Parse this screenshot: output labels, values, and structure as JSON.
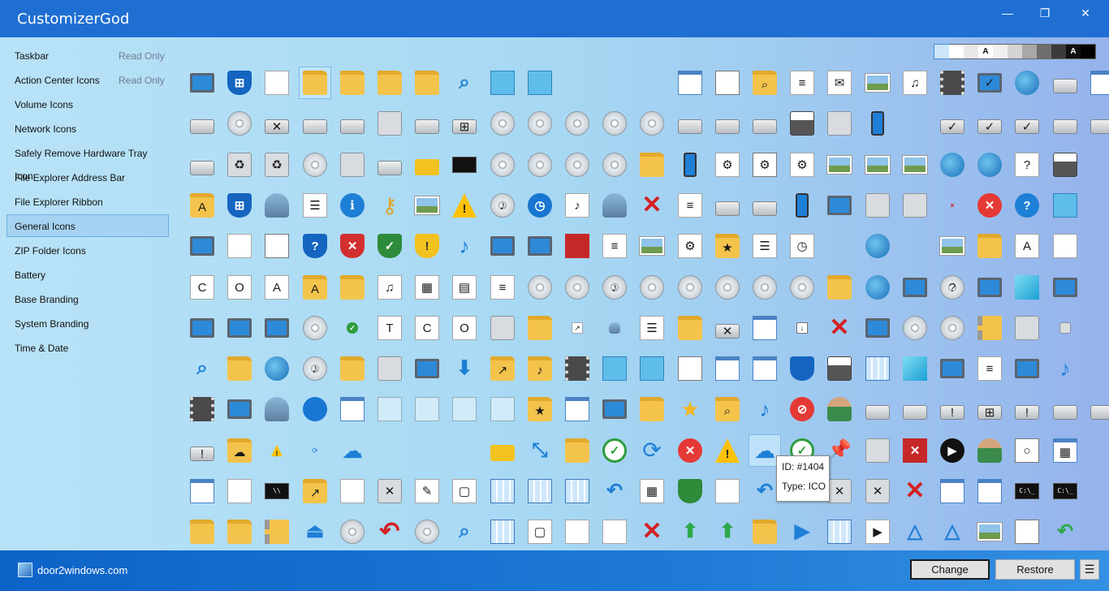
{
  "window": {
    "title": "CustomizerGod",
    "controls": {
      "minimize": "—",
      "maximize": "❐",
      "close": "✕"
    }
  },
  "sidebar": {
    "items": [
      {
        "label": "Taskbar",
        "badge": "Read Only"
      },
      {
        "label": "Action Center Icons",
        "badge": "Read Only"
      },
      {
        "label": "Volume Icons"
      },
      {
        "label": "Network Icons"
      },
      {
        "label": "Safely Remove Hardware Tray Icon"
      },
      {
        "label": "File Explorer Address Bar"
      },
      {
        "label": "File Explorer Ribbon"
      },
      {
        "label": "General Icons",
        "active": true
      },
      {
        "label": "ZIP Folder Icons"
      },
      {
        "label": "Battery"
      },
      {
        "label": "Base Branding"
      },
      {
        "label": "System Branding"
      },
      {
        "label": "Time & Date"
      }
    ]
  },
  "swatches": [
    {
      "color": "#cfe6fb",
      "selected": true
    },
    {
      "color": "#ffffff"
    },
    {
      "color": "#e8e8e8"
    },
    {
      "color": "#ffffff",
      "text": "A"
    },
    {
      "color": "#f0f0f0"
    },
    {
      "color": "#d4d4d4"
    },
    {
      "color": "#a8a8a8"
    },
    {
      "color": "#6e6e6e"
    },
    {
      "color": "#3a3a3a"
    },
    {
      "color": "#111111",
      "text": "A",
      "textColor": "#ffffff"
    },
    {
      "color": "#000000"
    }
  ],
  "grid": {
    "rows": [
      [
        "monitor",
        "winshield",
        "doc",
        "folder:sel",
        "folder",
        "folder",
        "folder-slim",
        "search-globe",
        "blue-folder",
        "blue-sliver",
        "empty",
        "empty",
        "empty",
        "window",
        "blank-tile",
        "folder-search",
        "doc-lines",
        "envelope",
        "picture",
        "music-doc",
        "film",
        "monitor-check",
        "globe-pc",
        "drive-pc",
        "id-card",
        "drive"
      ],
      [
        "drive",
        "disc-drive",
        "drive-x",
        "drive",
        "drive-green",
        "chip",
        "drive",
        "drive-win",
        "dvd",
        "dvd-r",
        "dvd-ram",
        "dvd-rom",
        "dvd-rw",
        "drive",
        "drive",
        "drive",
        "printer",
        "camcorder",
        "phone",
        "empty",
        "drive-check",
        "drive-check",
        "drive-check",
        "drive",
        "drive"
      ],
      [
        "drive-stack",
        "recycle",
        "recycle",
        "dvd",
        "camera",
        "drive",
        "lock",
        "sd-card",
        "disc",
        "cd-r",
        "cd-rom",
        "cd-rw",
        "board",
        "music-player",
        "gear-doc",
        "gear-tile",
        "gear-doc",
        "picture",
        "pictures",
        "picture",
        "globe-pc",
        "globe-pc",
        "help-pc",
        "printer"
      ],
      [
        "font-folder",
        "winshield",
        "people",
        "doc-list",
        "info",
        "key",
        "picture-red",
        "warning",
        "disc-music",
        "clock-blue",
        "audio-doc",
        "people",
        "x",
        "doc-lines",
        "drive",
        "drive-slim",
        "phone",
        "network",
        "scanner",
        "box",
        "x-small",
        "error",
        "help",
        "box-blue"
      ],
      [
        "monitor",
        "doc",
        "tile-small",
        "help-shield",
        "shield-x",
        "shield-check",
        "shield-warn",
        "music",
        "laptop",
        "monitor-blue",
        "apps",
        "doc-lines",
        "picture",
        "gear-doc",
        "star-folder",
        "list",
        "clock-doc",
        "empty",
        "globe-pc",
        "empty",
        "picture-red",
        "person-folder",
        "font-a",
        "certificate"
      ],
      [
        "certificate-c",
        "certificate-o",
        "font-a",
        "font-folder",
        "briefcase-person",
        "music-doc",
        "picture-doc",
        "film-doc",
        "doc-lines",
        "dvd",
        "dvd",
        "music-disc",
        "dvd",
        "hd-dvd",
        "bd",
        "vcd",
        "svcd",
        "green-folder",
        "globe",
        "search-pc",
        "help-disc",
        "sync-pc",
        "cube",
        "laptop-check"
      ],
      [
        "monitor-green",
        "monitor-tools",
        "network",
        "disc-red",
        "check-small",
        "font-tt",
        "font-c",
        "font-o",
        "audio",
        "folder-slim",
        "shortcut-small",
        "people-small",
        "list",
        "folder-doc",
        "drive-x",
        "id-card",
        "down-small",
        "x",
        "network",
        "dvd-r",
        "dvd-rw",
        "zip",
        "green-arrow-zip",
        "speaker-small"
      ],
      [
        "search",
        "people-folder",
        "globe-person",
        "music-add",
        "folder-card",
        "keyboard",
        "monitor-blue",
        "arrow-down",
        "folder-arrow",
        "folder-music",
        "film",
        "teal-door",
        "blue-corner",
        "blank-tile",
        "film-frame",
        "window",
        "shield-globe",
        "printer",
        "tiles",
        "cube",
        "monitor-doc",
        "doc-lines",
        "monitor",
        "music"
      ],
      [
        "film",
        "monitor-dark",
        "people",
        "molecule",
        "windows",
        "blank",
        "blank",
        "blank",
        "blank",
        "star-folder",
        "window-pic",
        "monitor-clock",
        "folder-yellow",
        "star",
        "folder-search",
        "music",
        "no-entry",
        "person",
        "drive-user",
        "drive-key",
        "drive-warning",
        "drive-win",
        "drive-warn",
        "drive-lock",
        "drive-key"
      ],
      [
        "drive-warning",
        "folder-cloud",
        "warning-small",
        "sync-small",
        "cloud",
        "empty",
        "empty",
        "empty",
        "lock",
        "arrows",
        "briefcase",
        "check-circle",
        "sync",
        "error",
        "warning",
        "cloud:sel",
        "check-circle",
        "pin",
        "pin-faint",
        "red-x-square",
        "play",
        "person",
        "disc-tile",
        "tiles-dark"
      ],
      [
        "window-blue",
        "clipboard",
        "terminal-blue",
        "folder-arrow",
        "docs",
        "recycle-x",
        "pencil",
        "copies",
        "tiles-blue",
        "tiles-blue",
        "tiles-blue",
        "undo",
        "grid-doc",
        "green-block",
        "doc-corner",
        "undo",
        "empty",
        "clock-x",
        "clock-x",
        "x",
        "window",
        "windows",
        "terminal",
        "terminal-person"
      ],
      [
        "folder-yellow",
        "folder-slim",
        "zip-doc",
        "eject",
        "disc-stop",
        "undo-red",
        "disc-drive",
        "search-net",
        "calendar",
        "copies",
        "doc",
        "doc",
        "x",
        "green-arrow",
        "green-arrow",
        "apps-arrow",
        "play-blue",
        "tiles-arrow",
        "play-box",
        "triangle",
        "triangle",
        "warning-pc",
        "white-tile",
        "undo-green"
      ]
    ]
  },
  "tooltip": {
    "id": "ID: #1404",
    "type": "Type: ICO"
  },
  "footer": {
    "brand": "door2windows.com",
    "change_label": "Change",
    "restore_label": "Restore",
    "menu_label": "☰"
  }
}
